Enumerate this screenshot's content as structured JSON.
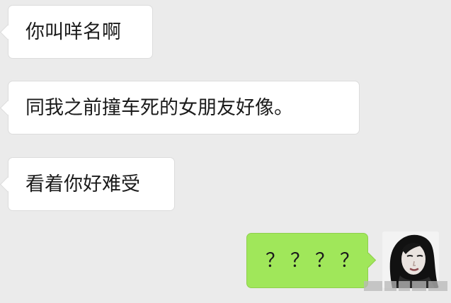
{
  "messages": [
    {
      "side": "left",
      "text": "你叫咩名啊"
    },
    {
      "side": "left",
      "text": "同我之前撞车死的女朋友好像。"
    },
    {
      "side": "left",
      "text": "看着你好难受"
    },
    {
      "side": "right",
      "text": "？？？？"
    }
  ],
  "colors": {
    "background": "#ebebeb",
    "incoming_bubble": "#ffffff",
    "outgoing_bubble": "#a0e75a"
  },
  "avatar": {
    "icon": "user-avatar-photo"
  }
}
